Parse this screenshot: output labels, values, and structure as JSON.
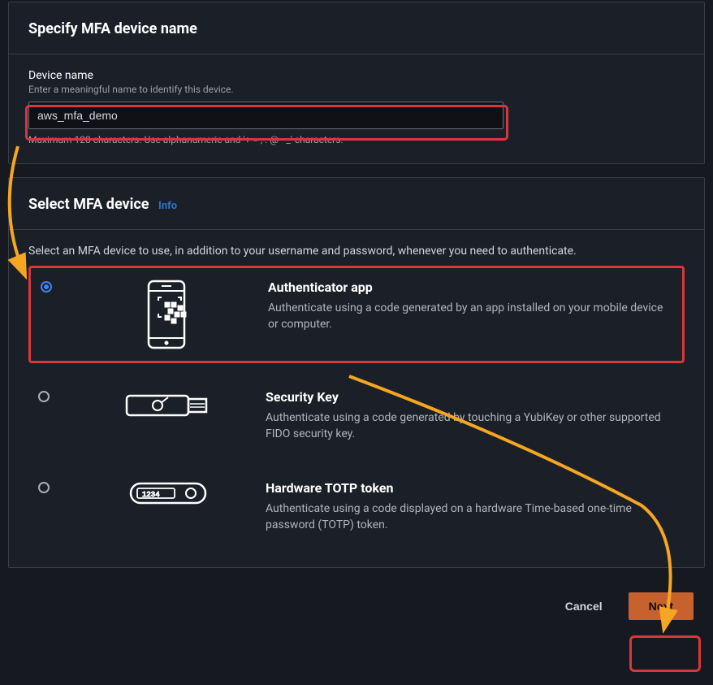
{
  "panel1": {
    "title": "Specify MFA device name",
    "device_name_label": "Device name",
    "device_name_desc": "Enter a meaningful name to identify this device.",
    "device_name_value": "aws_mfa_demo",
    "device_name_constraint": "Maximum 128 characters. Use alphanumeric and '+ = , . @ - _' characters."
  },
  "panel2": {
    "title": "Select MFA device",
    "info_label": "Info",
    "select_desc": "Select an MFA device to use, in addition to your username and password, whenever you need to authenticate.",
    "options": [
      {
        "title": "Authenticator app",
        "desc": "Authenticate using a code generated by an app installed on your mobile device or computer.",
        "selected": true
      },
      {
        "title": "Security Key",
        "desc": "Authenticate using a code generated by touching a YubiKey or other supported FIDO security key.",
        "selected": false
      },
      {
        "title": "Hardware TOTP token",
        "desc": "Authenticate using a code displayed on a hardware Time-based one-time password (TOTP) token.",
        "selected": false
      }
    ]
  },
  "footer": {
    "cancel": "Cancel",
    "next": "Next"
  },
  "colors": {
    "annotation_red": "#d9373e",
    "annotation_arrow": "#f5a623"
  }
}
